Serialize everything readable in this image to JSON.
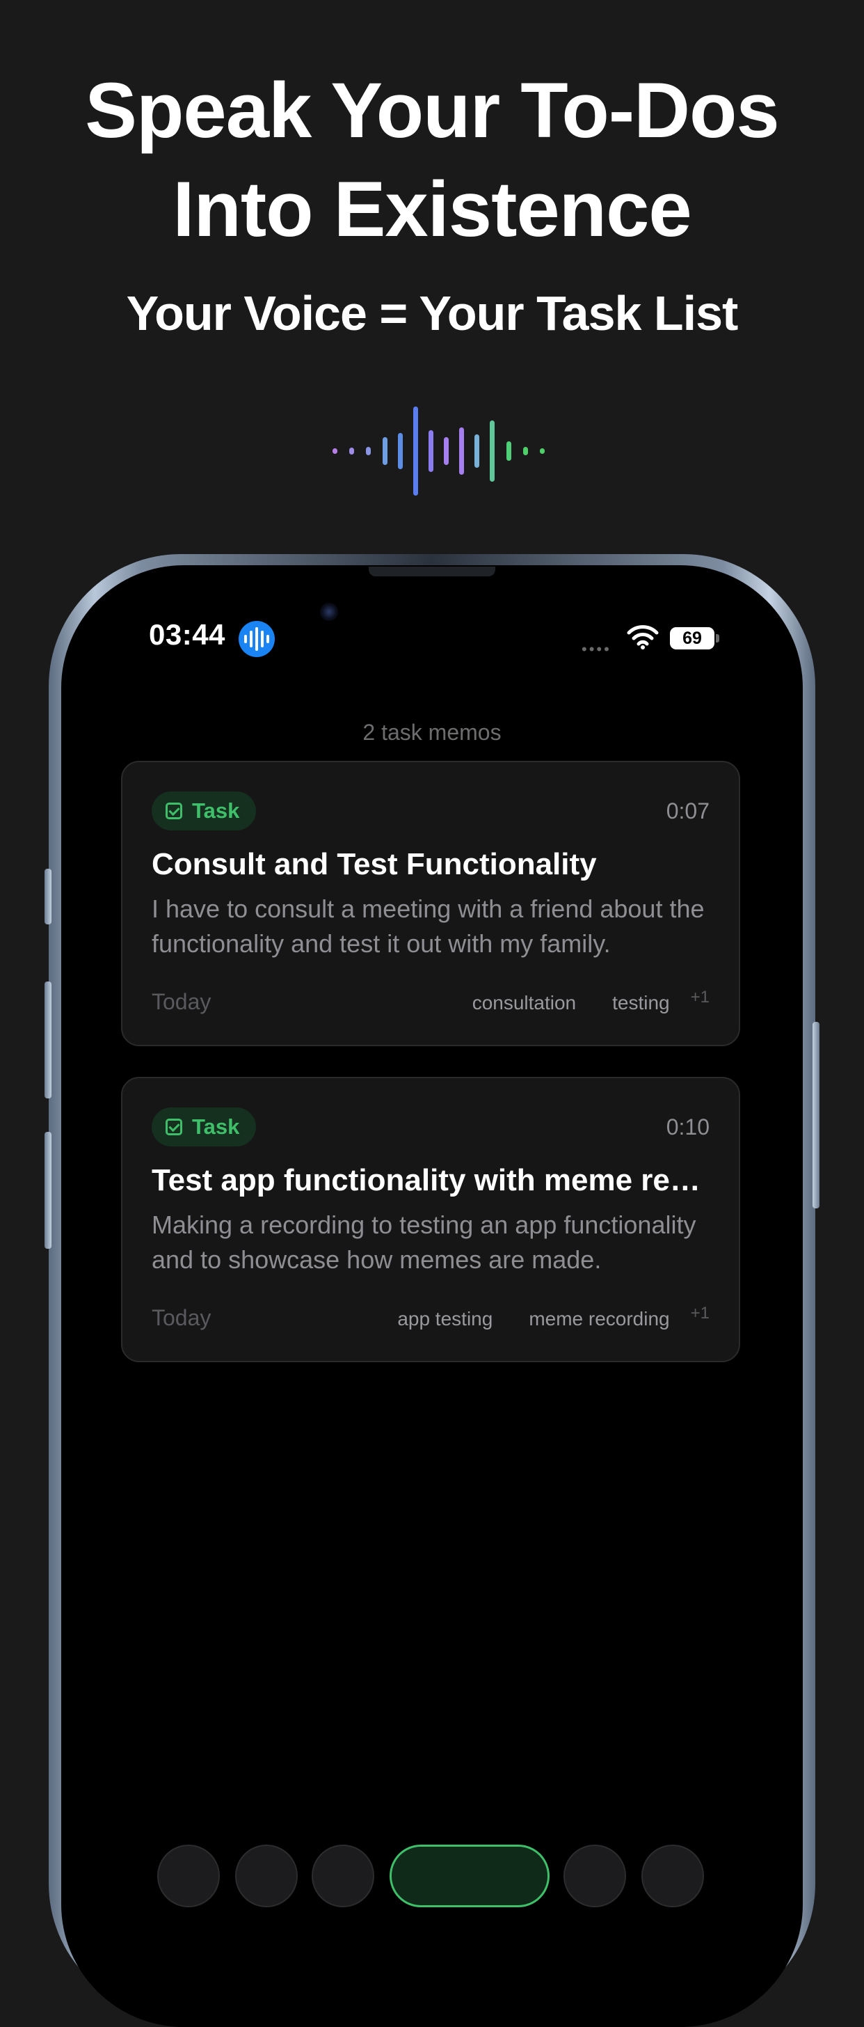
{
  "hero": {
    "headline_line1": "Speak Your To-Dos",
    "headline_line2": "Into Existence",
    "subhead": "Your Voice = Your Task List"
  },
  "status_bar": {
    "time": "03:44",
    "battery": "69"
  },
  "list": {
    "count_label": "2 task memos"
  },
  "memos": [
    {
      "badge": "Task",
      "duration": "0:07",
      "title": "Consult and Test Functionality",
      "body": "I have to consult a meeting with a friend about the functionality and test it out with my family.",
      "date": "Today",
      "tags": [
        "consultation",
        "testing"
      ],
      "more_tags": "+1"
    },
    {
      "badge": "Task",
      "duration": "0:10",
      "title": "Test app functionality with meme recording",
      "body": "Making a recording to testing an app functionality and to showcase how memes are made.",
      "date": "Today",
      "tags": [
        "app testing",
        "meme recording"
      ],
      "more_tags": "+1"
    }
  ],
  "colors": {
    "accent_green": "#3fbf6a",
    "siri_blue": "#1b84f5",
    "background": "#1a1a1b"
  },
  "icons": {
    "siri": "siri-waveform-icon",
    "wifi": "wifi-icon",
    "task": "checkbox-icon"
  }
}
